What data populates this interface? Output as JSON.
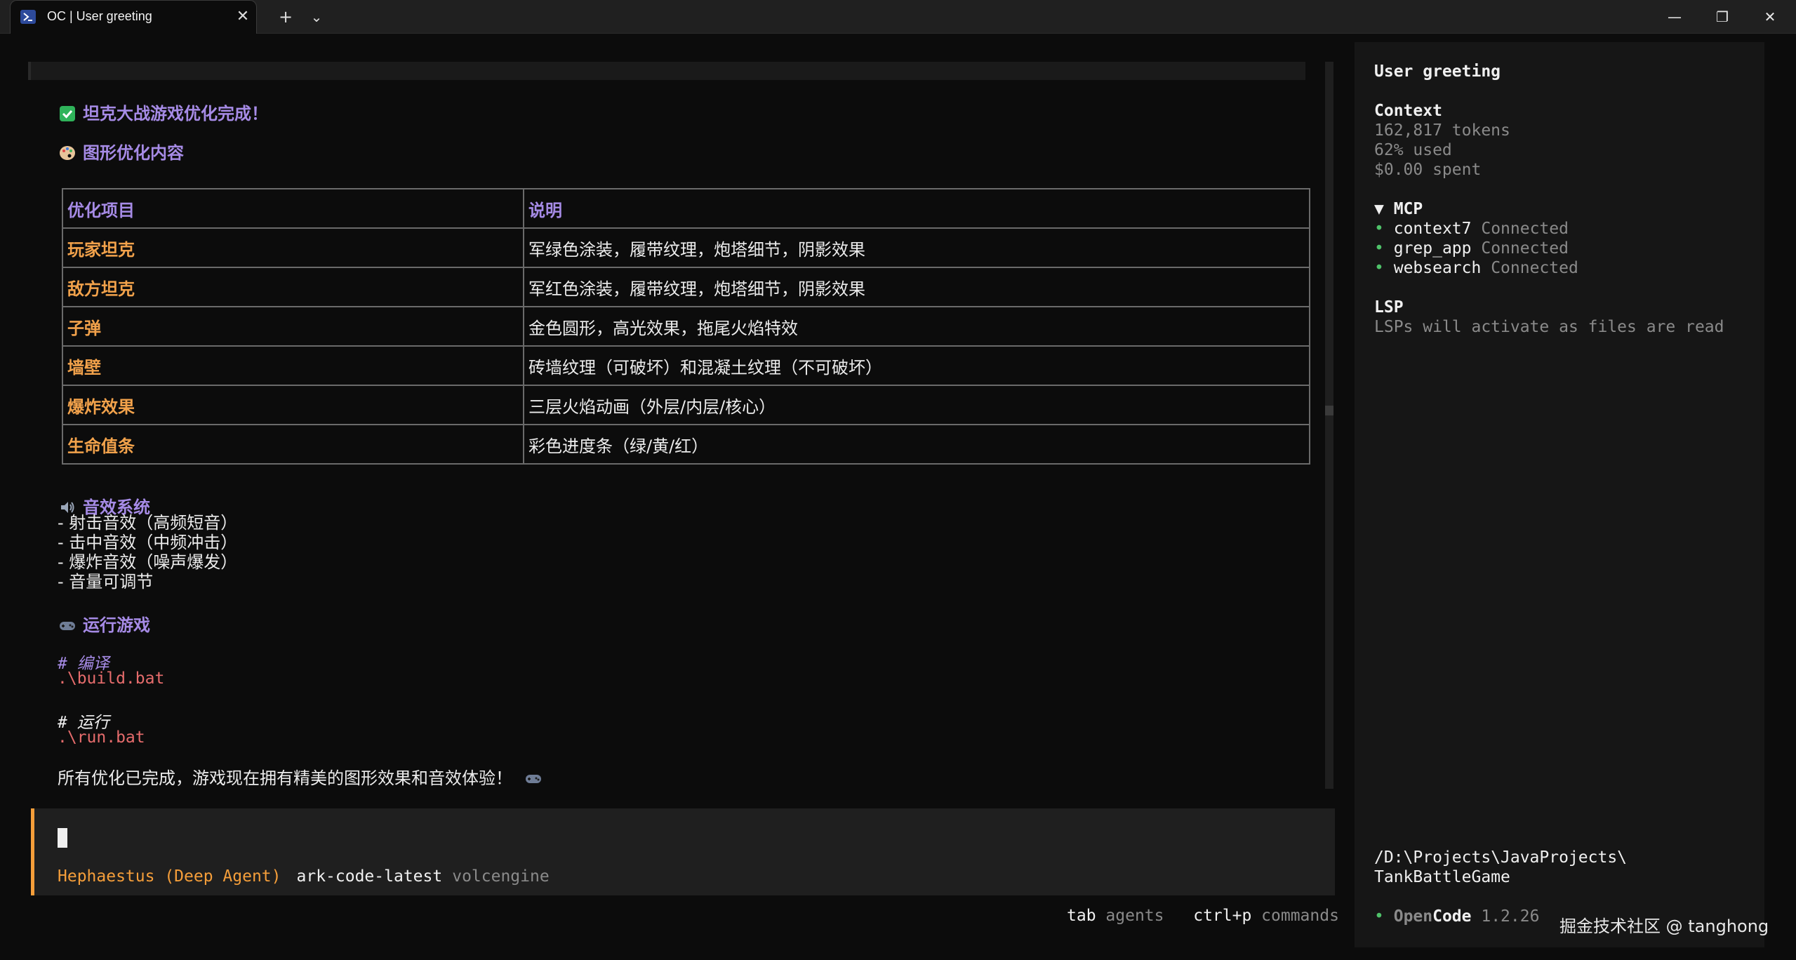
{
  "window": {
    "tab_title": "OC | User greeting",
    "tab_close": "✕",
    "new_tab": "+",
    "dropdown": "⌄",
    "minimize": "—",
    "restore": "❐",
    "close": "✕"
  },
  "chat": {
    "heading_done": "坦克大战游戏优化完成！",
    "heading_graphics": "图形优化内容",
    "table": {
      "headers": [
        "优化项目",
        "说明"
      ],
      "rows": [
        [
          "玩家坦克",
          "军绿色涂装，履带纹理，炮塔细节，阴影效果"
        ],
        [
          "敌方坦克",
          "军红色涂装，履带纹理，炮塔细节，阴影效果"
        ],
        [
          "子弹",
          "金色圆形，高光效果，拖尾火焰特效"
        ],
        [
          "墙壁",
          "砖墙纹理（可破坏）和混凝土纹理（不可破坏）"
        ],
        [
          "爆炸效果",
          "三层火焰动画（外层/内层/核心）"
        ],
        [
          "生命值条",
          "彩色进度条（绿/黄/红）"
        ]
      ]
    },
    "heading_sound": "音效系统",
    "sound_items": [
      "- 射击音效（高频短音）",
      "- 击中音效（中频冲击）",
      "- 爆炸音效（噪声爆发）",
      "- 音量可调节"
    ],
    "heading_run": "运行游戏",
    "code": {
      "comment1": "# 编译",
      "cmd1": ".\\build.bat",
      "comment2": "# 运行",
      "cmd2": ".\\run.bat"
    },
    "closing": "所有优化已完成，游戏现在拥有精美的图形效果和音效体验！"
  },
  "input": {
    "agent": "Hephaestus (Deep Agent)",
    "model": "ark-code-latest",
    "provider": "volcengine"
  },
  "hints": {
    "key1": "tab",
    "desc1": "agents",
    "key2": "ctrl+p",
    "desc2": "commands"
  },
  "sidebar": {
    "title": "User greeting",
    "context_label": "Context",
    "tokens": "162,817 tokens",
    "used": "62% used",
    "spent": "$0.00 spent",
    "mcp_label": "▼ MCP",
    "mcp_items": [
      {
        "name": "context7",
        "status": "Connected"
      },
      {
        "name": "grep_app",
        "status": "Connected"
      },
      {
        "name": "websearch",
        "status": "Connected"
      }
    ],
    "lsp_label": "LSP",
    "lsp_note": "LSPs will activate as files are read",
    "path_line1": "/D:\\Projects\\JavaProjects\\",
    "path_line2": "TankBattleGame",
    "brand_open": "Open",
    "brand_code": "Code",
    "version": "1.2.26"
  },
  "watermark": "掘金技术社区 @ tanghong",
  "colors": {
    "accent_orange": "#f59e3a",
    "heading_purple": "#a68be6",
    "status_green": "#4fc26a",
    "code_red": "#e66c6c"
  }
}
